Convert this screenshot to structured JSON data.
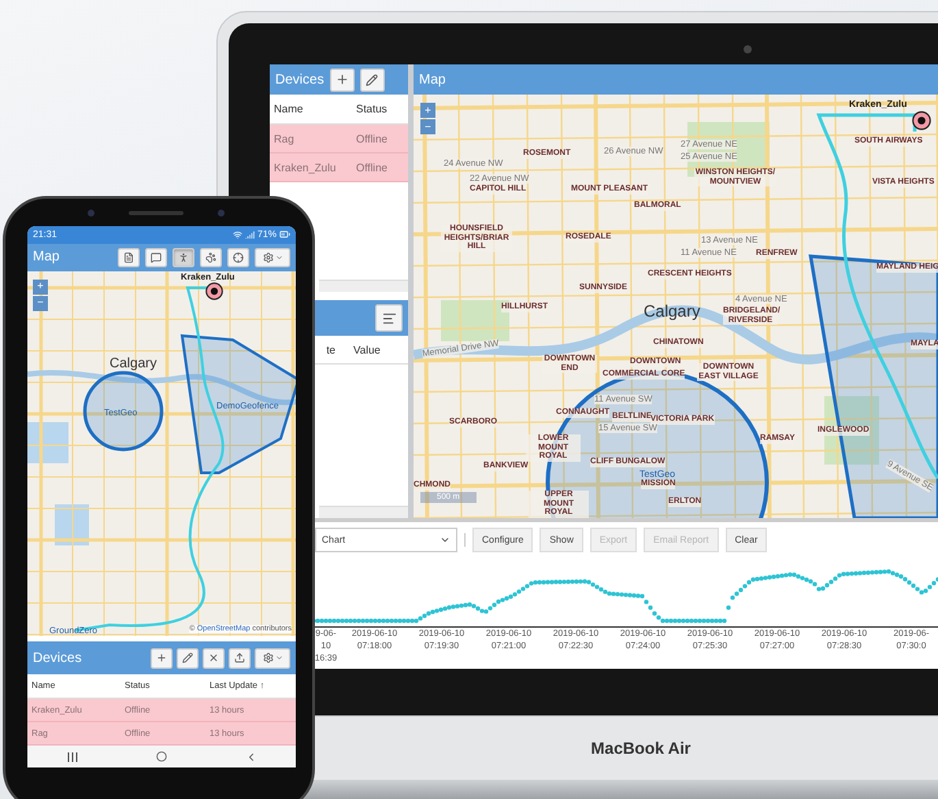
{
  "laptop": {
    "brand": "MacBook Air",
    "devices_panel": {
      "title": "Devices",
      "columns": [
        "Name",
        "Status"
      ],
      "rows": [
        {
          "name": "Rag",
          "status": "Offline",
          "alert": true
        },
        {
          "name": "Kraken_Zulu",
          "status": "Offline",
          "alert": true
        }
      ]
    },
    "values_panel": {
      "columns": [
        "te",
        "Value"
      ]
    },
    "map": {
      "title": "Map",
      "zoom_in": "+",
      "zoom_out": "−",
      "scale": "500 m",
      "marker": "Kraken_Zulu",
      "labels": [
        {
          "text": "ROSEMONT",
          "kind": "district"
        },
        {
          "text": "26 Avenue NW",
          "kind": "street"
        },
        {
          "text": "27 Avenue NE",
          "kind": "street"
        },
        {
          "text": "25 Avenue NE",
          "kind": "street"
        },
        {
          "text": "24 Avenue NW",
          "kind": "street"
        },
        {
          "text": "22 Avenue NW",
          "kind": "street"
        },
        {
          "text": "CAPITOL HILL",
          "kind": "district"
        },
        {
          "text": "MOUNT PLEASANT",
          "kind": "district"
        },
        {
          "text": "WINSTON HEIGHTS/ MOUNTVIEW",
          "kind": "district"
        },
        {
          "text": "BALMORAL",
          "kind": "district"
        },
        {
          "text": "SOUTH AIRWAYS",
          "kind": "district"
        },
        {
          "text": "VISTA HEIGHTS",
          "kind": "district"
        },
        {
          "text": "HOUNSFIELD HEIGHTS/BRIAR HILL",
          "kind": "district"
        },
        {
          "text": "ROSEDALE",
          "kind": "district"
        },
        {
          "text": "13 Avenue NE",
          "kind": "street"
        },
        {
          "text": "11 Avenue NE",
          "kind": "street"
        },
        {
          "text": "RENFREW",
          "kind": "district"
        },
        {
          "text": "CRESCENT HEIGHTS",
          "kind": "district"
        },
        {
          "text": "MAYLAND HEIG",
          "kind": "district"
        },
        {
          "text": "SUNNYSIDE",
          "kind": "district"
        },
        {
          "text": "HILLHURST",
          "kind": "district"
        },
        {
          "text": "Calgary",
          "kind": "city"
        },
        {
          "text": "4 Avenue NE",
          "kind": "street"
        },
        {
          "text": "BRIDGELAND/ RIVERSIDE",
          "kind": "district"
        },
        {
          "text": "CHINATOWN",
          "kind": "district"
        },
        {
          "text": "Memorial Drive NW",
          "kind": "street"
        },
        {
          "text": "DOWNTOWN END",
          "kind": "district"
        },
        {
          "text": "DOWNTOWN",
          "kind": "district"
        },
        {
          "text": "COMMERCIAL CORE",
          "kind": "district"
        },
        {
          "text": "DOWNTOWN EAST VILLAGE",
          "kind": "district"
        },
        {
          "text": "11 Avenue SW",
          "kind": "street"
        },
        {
          "text": "CONNAUGHT",
          "kind": "district"
        },
        {
          "text": "BELTLINE",
          "kind": "district"
        },
        {
          "text": "VICTORIA PARK",
          "kind": "district"
        },
        {
          "text": "15 Avenue SW",
          "kind": "street"
        },
        {
          "text": "SCARBORO",
          "kind": "district"
        },
        {
          "text": "LOWER MOUNT ROYAL",
          "kind": "district"
        },
        {
          "text": "RAMSAY",
          "kind": "district"
        },
        {
          "text": "INGLEWOOD",
          "kind": "district"
        },
        {
          "text": "9 Avenue SE",
          "kind": "street"
        },
        {
          "text": "CLIFF BUNGALOW",
          "kind": "district"
        },
        {
          "text": "TestGeo",
          "kind": "geofence"
        },
        {
          "text": "MISSION",
          "kind": "district"
        },
        {
          "text": "BANKVIEW",
          "kind": "district"
        },
        {
          "text": "CHMOND",
          "kind": "district"
        },
        {
          "text": "UPPER MOUNT ROYAL",
          "kind": "district"
        },
        {
          "text": "ERLTON",
          "kind": "district"
        },
        {
          "text": "MAYLA",
          "kind": "district"
        }
      ]
    },
    "report_toolbar": {
      "select": "Chart",
      "buttons": [
        {
          "label": "Configure",
          "disabled": false
        },
        {
          "label": "Show",
          "disabled": false
        },
        {
          "label": "Export",
          "disabled": true
        },
        {
          "label": "Email Report",
          "disabled": true
        },
        {
          "label": "Clear",
          "disabled": false
        }
      ]
    },
    "chart_axis_labels": [
      {
        "date": "9-06-10",
        "time": "16:39"
      },
      {
        "date": "2019-06-10",
        "time": "07:18:00"
      },
      {
        "date": "2019-06-10",
        "time": "07:19:30"
      },
      {
        "date": "2019-06-10",
        "time": "07:21:00"
      },
      {
        "date": "2019-06-10",
        "time": "07:22:30"
      },
      {
        "date": "2019-06-10",
        "time": "07:24:00"
      },
      {
        "date": "2019-06-10",
        "time": "07:25:30"
      },
      {
        "date": "2019-06-10",
        "time": "07:27:00"
      },
      {
        "date": "2019-06-10",
        "time": "07:28:30"
      },
      {
        "date": "2019-06-",
        "time": "07:30:0"
      }
    ]
  },
  "phone": {
    "status_bar": {
      "time": "21:31",
      "battery": "71%"
    },
    "map": {
      "title": "Map",
      "zoom_in": "+",
      "zoom_out": "−",
      "tools": [
        {
          "kind": "document",
          "selected": false
        },
        {
          "kind": "chat",
          "selected": false
        },
        {
          "kind": "person",
          "selected": true
        },
        {
          "kind": "paw",
          "selected": false
        },
        {
          "kind": "crosshair",
          "selected": false
        },
        {
          "kind": "settings",
          "selected": false
        }
      ],
      "labels": [
        {
          "text": "Kraken_Zulu",
          "kind": "marker"
        },
        {
          "text": "Calgary",
          "kind": "city"
        },
        {
          "text": "TestGeo",
          "kind": "geofence"
        },
        {
          "text": "DemoGeofence",
          "kind": "geofence"
        },
        {
          "text": "GroundZero",
          "kind": "geofence"
        }
      ],
      "attribution": {
        "prefix": "©",
        "link": "OpenStreetMap",
        "suffix": "contributors"
      }
    },
    "devices_panel": {
      "title": "Devices",
      "tools": [
        {
          "kind": "add"
        },
        {
          "kind": "edit"
        },
        {
          "kind": "delete"
        },
        {
          "kind": "upload"
        },
        {
          "kind": "settings"
        }
      ],
      "columns": [
        "Name",
        "Status",
        "Last Update ↑"
      ],
      "rows": [
        {
          "name": "Kraken_Zulu",
          "status": "Offline",
          "updated": "13 hours",
          "alert": true
        },
        {
          "name": "Rag",
          "status": "Offline",
          "updated": "13 hours",
          "alert": true
        }
      ]
    }
  }
}
